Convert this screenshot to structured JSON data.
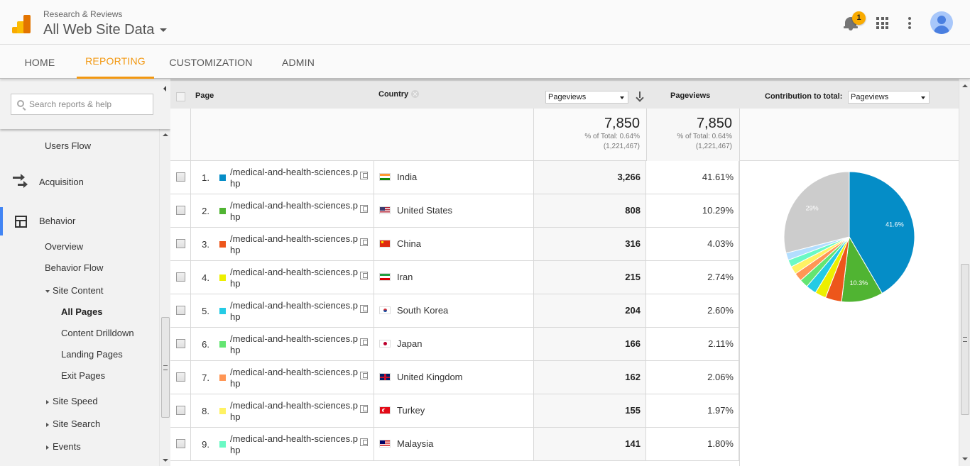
{
  "header": {
    "account": "Research & Reviews",
    "property": "All Web Site Data",
    "notification_count": "1"
  },
  "nav": {
    "tabs": [
      {
        "label": "HOME"
      },
      {
        "label": "REPORTING",
        "active": true
      },
      {
        "label": "CUSTOMIZATION"
      },
      {
        "label": "ADMIN"
      }
    ]
  },
  "sidebar": {
    "search_placeholder": "Search reports & help",
    "items": {
      "users_flow": "Users Flow",
      "acquisition": "Acquisition",
      "behavior": "Behavior",
      "overview": "Overview",
      "behavior_flow": "Behavior Flow",
      "site_content": "Site Content",
      "all_pages": "All Pages",
      "content_drilldown": "Content Drilldown",
      "landing_pages": "Landing Pages",
      "exit_pages": "Exit Pages",
      "site_speed": "Site Speed",
      "site_search": "Site Search",
      "events": "Events"
    }
  },
  "table": {
    "headers": {
      "page": "Page",
      "country": "Country",
      "metric_select": "Pageviews",
      "pageviews": "Pageviews",
      "contribution_label": "Contribution to total:",
      "contribution_select": "Pageviews"
    },
    "totals": {
      "value": "7,850",
      "pct_of_total": "% of Total: 0.64%",
      "site_total": "(1,221,467)",
      "value2": "7,850",
      "pct_of_total2": "% of Total: 0.64%",
      "site_total2": "(1,221,467)"
    },
    "rows": [
      {
        "index": "1.",
        "page": "/medical-and-health-sciences.php",
        "country": "India",
        "flag": "in",
        "pageviews": "3,266",
        "pct": "41.61%",
        "color": "#058dc7"
      },
      {
        "index": "2.",
        "page": "/medical-and-health-sciences.php",
        "country": "United States",
        "flag": "us",
        "pageviews": "808",
        "pct": "10.29%",
        "color": "#50b432"
      },
      {
        "index": "3.",
        "page": "/medical-and-health-sciences.php",
        "country": "China",
        "flag": "cn",
        "pageviews": "316",
        "pct": "4.03%",
        "color": "#ed561b"
      },
      {
        "index": "4.",
        "page": "/medical-and-health-sciences.php",
        "country": "Iran",
        "flag": "ir",
        "pageviews": "215",
        "pct": "2.74%",
        "color": "#edef00"
      },
      {
        "index": "5.",
        "page": "/medical-and-health-sciences.php",
        "country": "South Korea",
        "flag": "kr",
        "pageviews": "204",
        "pct": "2.60%",
        "color": "#24cbe5"
      },
      {
        "index": "6.",
        "page": "/medical-and-health-sciences.php",
        "country": "Japan",
        "flag": "jp",
        "pageviews": "166",
        "pct": "2.11%",
        "color": "#64e572"
      },
      {
        "index": "7.",
        "page": "/medical-and-health-sciences.php",
        "country": "United Kingdom",
        "flag": "gb",
        "pageviews": "162",
        "pct": "2.06%",
        "color": "#ff9655"
      },
      {
        "index": "8.",
        "page": "/medical-and-health-sciences.php",
        "country": "Turkey",
        "flag": "tr",
        "pageviews": "155",
        "pct": "1.97%",
        "color": "#fff263"
      },
      {
        "index": "9.",
        "page": "/medical-and-health-sciences.php",
        "country": "Malaysia",
        "flag": "my",
        "pageviews": "141",
        "pct": "1.80%",
        "color": "#6af9c4"
      }
    ]
  },
  "chart_data": {
    "type": "pie",
    "title": "Contribution to total: Pageviews",
    "slices": [
      {
        "label": "India",
        "value": 41.61,
        "color": "#058dc7",
        "data_label": "41.6%"
      },
      {
        "label": "United States",
        "value": 10.29,
        "color": "#50b432",
        "data_label": "10.3%"
      },
      {
        "label": "China",
        "value": 4.03,
        "color": "#ed561b"
      },
      {
        "label": "Iran",
        "value": 2.74,
        "color": "#edef00"
      },
      {
        "label": "South Korea",
        "value": 2.6,
        "color": "#24cbe5"
      },
      {
        "label": "Japan",
        "value": 2.11,
        "color": "#64e572"
      },
      {
        "label": "United Kingdom",
        "value": 2.06,
        "color": "#ff9655"
      },
      {
        "label": "Turkey",
        "value": 1.97,
        "color": "#fff263"
      },
      {
        "label": "Malaysia",
        "value": 1.8,
        "color": "#6af9c4"
      },
      {
        "label": "Row 10",
        "value": 1.8,
        "color": "#b2deff"
      },
      {
        "label": "Other",
        "value": 28.99,
        "color": "#cccccc",
        "data_label": "29%"
      }
    ]
  }
}
